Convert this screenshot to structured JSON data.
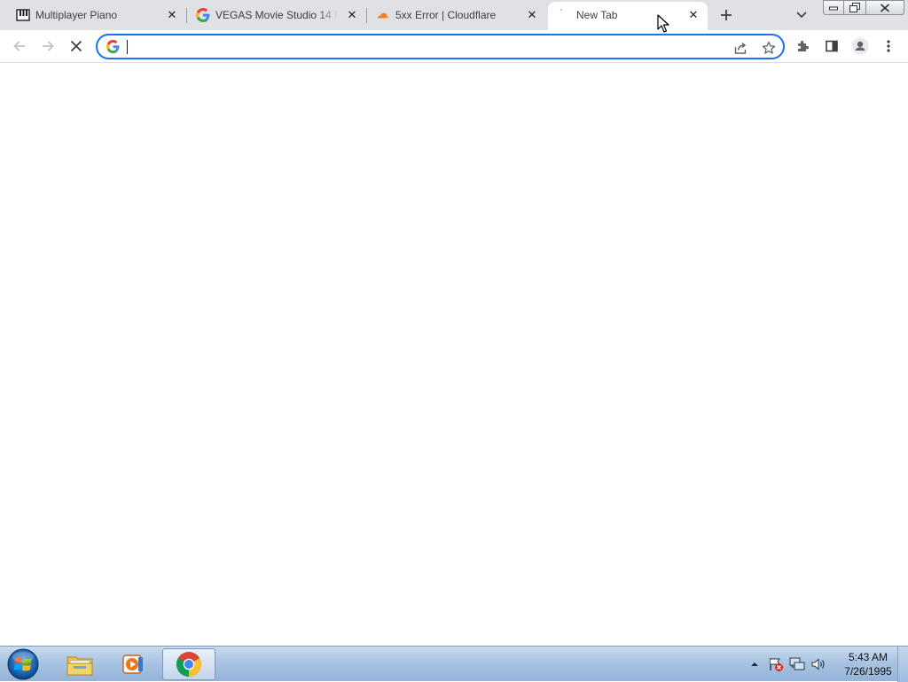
{
  "tabs": [
    {
      "title": "Multiplayer Piano",
      "icon": "piano-icon",
      "active": false
    },
    {
      "title": "VEGAS Movie Studio 14 Pl",
      "icon": "google-icon",
      "active": false
    },
    {
      "title": "5xx Error | Cloudflare",
      "icon": "cloudflare-icon",
      "active": false
    },
    {
      "title": "New Tab",
      "icon": "loading-icon",
      "active": true
    }
  ],
  "toolbar": {
    "omnibox_value": "",
    "accent_color": "#1a73e8"
  },
  "taskbar": {
    "apps": [
      {
        "name": "Windows Explorer",
        "icon": "folder-icon",
        "active": false
      },
      {
        "name": "Windows Media Player",
        "icon": "media-player-icon",
        "active": false
      },
      {
        "name": "Google Chrome",
        "icon": "chrome-icon",
        "active": true
      }
    ],
    "clock": {
      "time": "5:43 AM",
      "date": "7/26/1995"
    }
  }
}
